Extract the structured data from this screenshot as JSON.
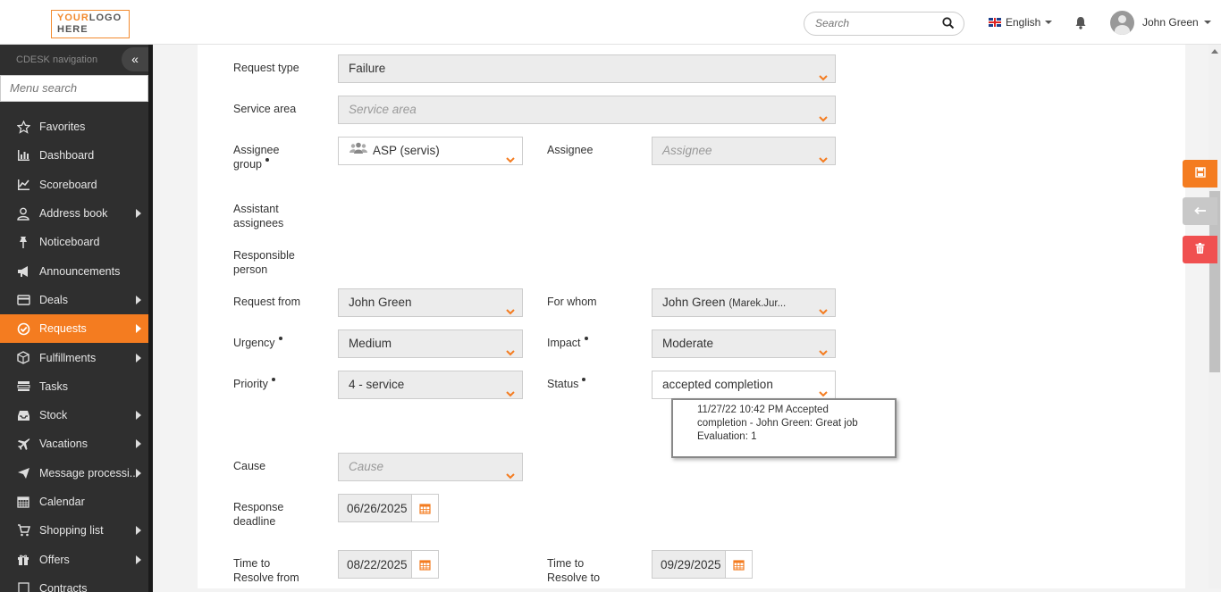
{
  "header": {
    "logo_line1_a": "YOUR",
    "logo_line1_b": "LOGO",
    "logo_line2": "HERE",
    "search_placeholder": "Search",
    "language": "English",
    "user_name": "John Green"
  },
  "sidebar": {
    "title": "CDESK navigation",
    "collapse_label": "«",
    "menu_search_placeholder": "Menu search",
    "items": [
      {
        "label": "Favorites",
        "icon": "star-icon"
      },
      {
        "label": "Dashboard",
        "icon": "bar-chart-icon"
      },
      {
        "label": "Scoreboard",
        "icon": "line-chart-icon"
      },
      {
        "label": "Address book",
        "icon": "user-icon"
      },
      {
        "label": "Noticeboard",
        "icon": "pushpin-icon"
      },
      {
        "label": "Announcements",
        "icon": "megaphone-icon"
      },
      {
        "label": "Deals",
        "icon": "card-icon"
      },
      {
        "label": "Requests",
        "icon": "check-circle-icon"
      },
      {
        "label": "Fulfillments",
        "icon": "box-icon"
      },
      {
        "label": "Tasks",
        "icon": "tasks-icon"
      },
      {
        "label": "Stock",
        "icon": "inbox-icon"
      },
      {
        "label": "Vacations",
        "icon": "plane-icon"
      },
      {
        "label": "Message processi...",
        "icon": "paper-plane-icon"
      },
      {
        "label": "Calendar",
        "icon": "calendar-icon"
      },
      {
        "label": "Shopping list",
        "icon": "cart-icon"
      },
      {
        "label": "Offers",
        "icon": "gift-icon"
      },
      {
        "label": "Contracts",
        "icon": "contract-icon"
      }
    ]
  },
  "form": {
    "request_type": {
      "label": "Request type",
      "value": "Failure"
    },
    "service_area": {
      "label": "Service area",
      "placeholder": "Service area"
    },
    "assignee_group": {
      "label_1": "Assignee",
      "label_2": "group",
      "value": "ASP (servis)"
    },
    "assignee": {
      "label": "Assignee",
      "placeholder": "Assignee"
    },
    "assistant_assignees": {
      "label_1": "Assistant",
      "label_2": "assignees"
    },
    "responsible_person": {
      "label_1": "Responsible",
      "label_2": "person"
    },
    "request_from": {
      "label": "Request from",
      "value": "John Green"
    },
    "for_whom": {
      "label": "For whom",
      "value": "John Green",
      "value_extra": "(Marek.Jur..."
    },
    "urgency": {
      "label": "Urgency",
      "value": "Medium"
    },
    "impact": {
      "label": "Impact",
      "value": "Moderate"
    },
    "priority": {
      "label": "Priority",
      "value": "4 - service"
    },
    "status": {
      "label": "Status",
      "value": "accepted completion"
    },
    "status_tooltip": {
      "line1": "11/27/22 10:42 PM Accepted",
      "line2": "completion - John Green: Great job",
      "line3": "Evaluation: 1"
    },
    "cause": {
      "label": "Cause",
      "placeholder": "Cause"
    },
    "response_deadline": {
      "label_1": "Response",
      "label_2": "deadline",
      "value": "06/26/2025"
    },
    "time_to_resolve_from": {
      "label_1": "Time to",
      "label_2": "Resolve from",
      "value": "08/22/2025"
    },
    "time_to_resolve_to": {
      "label_1": "Time to",
      "label_2": "Resolve to",
      "value": "09/29/2025"
    }
  },
  "colors": {
    "accent": "#f47c20",
    "danger": "#f05050",
    "sidebar_bg": "#2f2f2f"
  }
}
